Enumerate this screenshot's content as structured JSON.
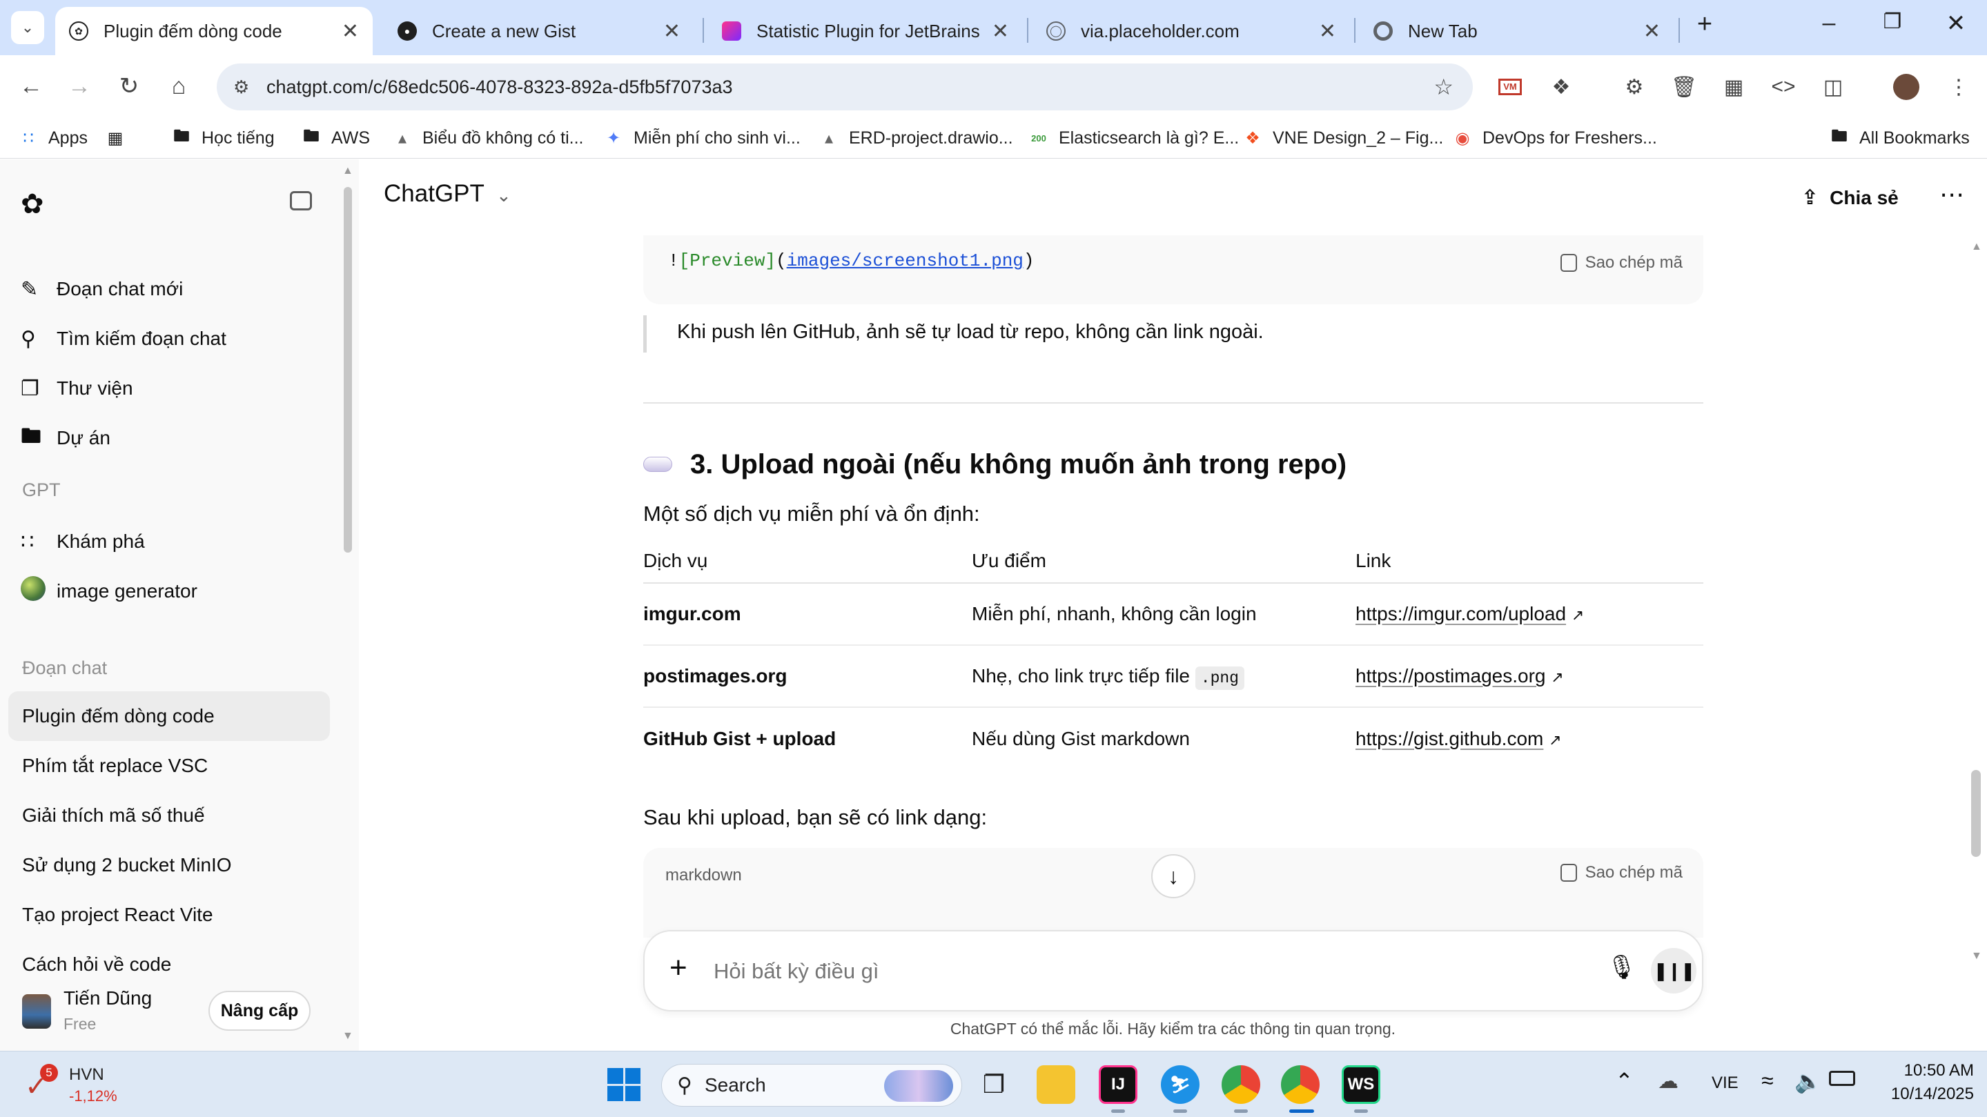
{
  "browser": {
    "tabs": [
      {
        "title": "Plugin đếm dòng code",
        "active": true
      },
      {
        "title": "Create a new Gist",
        "active": false
      },
      {
        "title": "Statistic Plugin for JetBrains IDE",
        "active": false
      },
      {
        "title": "via.placeholder.com",
        "active": false
      },
      {
        "title": "New Tab",
        "active": false
      }
    ],
    "url": "chatgpt.com/c/68edc506-4078-8323-892a-d5fb5f7073a3",
    "bookmarks": [
      {
        "label": "Apps",
        "icon": "apps-grid-icon"
      },
      {
        "label": "",
        "icon": "tab-groups-icon"
      },
      {
        "label": "Học tiếng",
        "icon": "folder-icon"
      },
      {
        "label": "AWS",
        "icon": "folder-icon"
      },
      {
        "label": "Biểu đồ không có ti...",
        "icon": "drawio-icon"
      },
      {
        "label": "Miễn phí cho sinh vi...",
        "icon": "gemini-icon"
      },
      {
        "label": "ERD-project.drawio...",
        "icon": "drawio-icon"
      },
      {
        "label": "Elasticsearch là gì? E...",
        "icon": "200lab-icon"
      },
      {
        "label": "VNE Design_2 – Fig...",
        "icon": "figma-icon"
      },
      {
        "label": "DevOps for Freshers...",
        "icon": "devops-icon"
      }
    ],
    "all_bookmarks": "All Bookmarks"
  },
  "sidebar": {
    "menu": [
      {
        "label": "Đoạn chat mới",
        "icon": "edit-icon"
      },
      {
        "label": "Tìm kiếm đoạn chat",
        "icon": "search-icon"
      },
      {
        "label": "Thư viện",
        "icon": "library-icon"
      },
      {
        "label": "Dự án",
        "icon": "folder-plus-icon"
      }
    ],
    "gpt_section": "GPT",
    "gpts": [
      {
        "label": "Khám phá",
        "icon": "explore-grid-icon"
      },
      {
        "label": "image generator",
        "icon": "image-generator-avatar"
      }
    ],
    "chats_section": "Đoạn chat",
    "chats": [
      "Plugin đếm dòng code",
      "Phím tắt replace VSC",
      "Giải thích mã số thuế",
      "Sử dụng 2 bucket MinIO",
      "Tạo project React Vite",
      "Cách hỏi về code"
    ],
    "user": {
      "name": "Tiến Dũng",
      "plan": "Free",
      "upgrade": "Nâng cấp"
    }
  },
  "header": {
    "model": "ChatGPT",
    "share": "Chia sẻ"
  },
  "conversation": {
    "code1": {
      "bang": "!",
      "alt": "[Preview]",
      "open": "(",
      "path": "images/screenshot1.png",
      "close": ")",
      "copy": "Sao chép mã"
    },
    "quote": "Khi push lên GitHub, ảnh sẽ tự load từ repo, không cần link ngoài.",
    "heading": "3. Upload ngoài (nếu không muốn ảnh trong repo)",
    "intro": "Một số dịch vụ miễn phí và ổn định:",
    "table": {
      "headers": [
        "Dịch vụ",
        "Ưu điểm",
        "Link"
      ],
      "rows": [
        {
          "service": "imgur.com",
          "pros": "Miễn phí, nhanh, không cần login",
          "code": "",
          "link": "https://imgur.com/upload"
        },
        {
          "service": "postimages.org",
          "pros": "Nhẹ, cho link trực tiếp file",
          "code": ".png",
          "link": "https://postimages.org"
        },
        {
          "service": "GitHub Gist + upload",
          "pros": "Nếu dùng Gist markdown",
          "code": "",
          "link": "https://gist.github.com"
        }
      ]
    },
    "after": "Sau khi upload, bạn sẽ có link dạng:",
    "code2": {
      "lang": "markdown",
      "copy": "Sao chép mã"
    }
  },
  "composer": {
    "placeholder": "Hỏi bất kỳ điều gì"
  },
  "disclaimer": "ChatGPT có thể mắc lỗi. Hãy kiểm tra các thông tin quan trọng.",
  "taskbar": {
    "stock": {
      "name": "HVN",
      "change": "-1,12%",
      "badge": "5"
    },
    "search": "Search",
    "lang": "VIE",
    "time": "10:50 AM",
    "date": "10/14/2025"
  },
  "colors": {
    "tabstrip": "#d3e3fd",
    "sidebar": "#f9f9f9",
    "taskbar": "#dde8f5",
    "code_alt": "#2a8a2a",
    "code_link": "#1b4fd6"
  }
}
